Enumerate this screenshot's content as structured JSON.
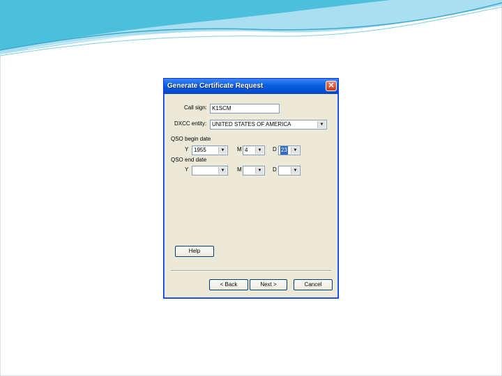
{
  "dialog": {
    "title": "Generate Certificate Request",
    "callsign_label": "Call sign:",
    "callsign_value": "K1SCM",
    "dxcc_label": "DXCC entity:",
    "dxcc_value": "UNITED STATES OF AMERICA",
    "qso_begin_label": "QSO begin date",
    "qso_end_label": "QSO end date",
    "y_label": "Y",
    "m_label": "M",
    "d_label": "D",
    "begin_year": "1955",
    "begin_month": "4",
    "begin_day": "23",
    "end_year": "",
    "end_month": "",
    "end_day": "",
    "help_button": "Help",
    "back_button": "< Back",
    "next_button": "Next >",
    "cancel_button": "Cancel"
  },
  "colors": {
    "titlebar": "#0a5fe0",
    "dialog_bg": "#ece9d8",
    "swoosh_primary": "#4bbfdc",
    "swoosh_light": "#a9dff0"
  },
  "icons": {
    "close": "close-x-icon",
    "dropdown": "chevron-down-icon"
  }
}
